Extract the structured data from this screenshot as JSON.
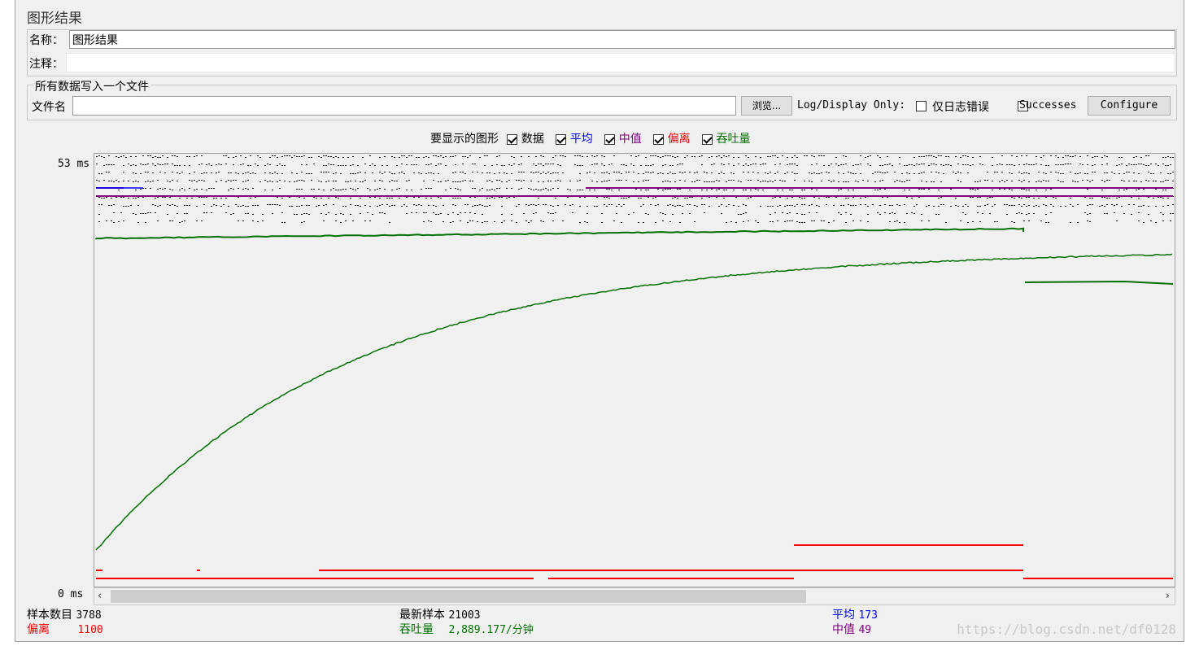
{
  "panel_title": "图形结果",
  "name_label": "名称：",
  "name_value": "图形结果",
  "comment_label": "注释：",
  "comment_value": "",
  "file_group": {
    "legend": "所有数据写入一个文件",
    "filename_label": "文件名",
    "filename_value": "",
    "browse_button": "浏览...",
    "log_display_label": "Log/Display Only:",
    "errors_only_label": "仅日志错误",
    "successes_label": "Successes",
    "configure_button": "Configure"
  },
  "graph_options": {
    "label": "要显示的图形",
    "items": [
      {
        "label": "数据",
        "checked": true,
        "color": "#000000"
      },
      {
        "label": "平均",
        "checked": true,
        "color": "#0000ff"
      },
      {
        "label": "中值",
        "checked": true,
        "color": "#800080"
      },
      {
        "label": "偏离",
        "checked": true,
        "color": "#ff0000"
      },
      {
        "label": "吞吐量",
        "checked": true,
        "color": "#007000"
      }
    ]
  },
  "chart_data": {
    "type": "line",
    "y_max_label": "53 ms",
    "y_min_label": "0 ms",
    "colors": {
      "data": "#000000",
      "average": "#0000ff",
      "median": "#800080",
      "deviation": "#ff0000",
      "throughput": "#007000"
    }
  },
  "stats": {
    "sample_count_label": "样本数目",
    "sample_count": "3788",
    "latest_sample_label": "最新样本",
    "latest_sample": "21003",
    "average_label": "平均",
    "average": "173",
    "deviation_label": "偏离",
    "deviation": "1100",
    "throughput_label": "吞吐量",
    "throughput": "2,889.177/分钟",
    "median_label": "中值",
    "median": "49"
  },
  "watermark": "https://blog.csdn.net/df0128"
}
